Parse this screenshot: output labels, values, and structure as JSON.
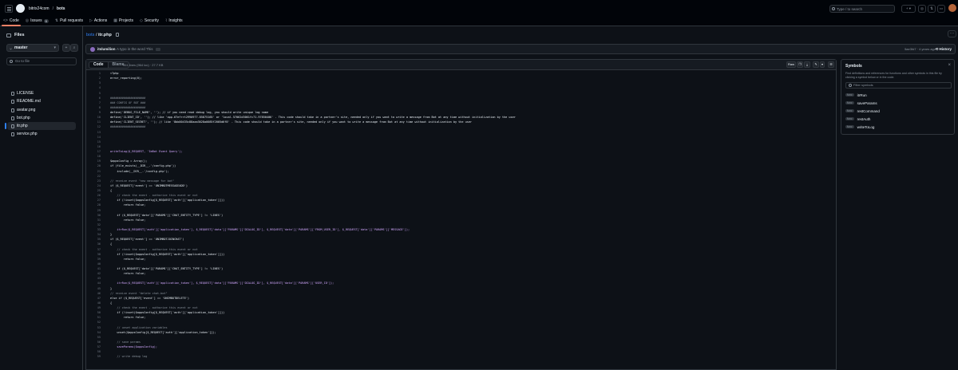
{
  "header": {
    "owner": "bitrix24com",
    "repo": "bots",
    "search_placeholder": "Type / to search",
    "add_label": "+ ▾"
  },
  "tabs": [
    {
      "label": "Code",
      "icon": "code-icon",
      "active": true
    },
    {
      "label": "Issues",
      "icon": "issue-icon",
      "count": "9"
    },
    {
      "label": "Pull requests",
      "icon": "pull-request-icon"
    },
    {
      "label": "Actions",
      "icon": "play-icon"
    },
    {
      "label": "Projects",
      "icon": "table-icon"
    },
    {
      "label": "Security",
      "icon": "shield-icon"
    },
    {
      "label": "Insights",
      "icon": "graph-icon"
    }
  ],
  "sidebar": {
    "title": "Files",
    "branch": "master",
    "goto_placeholder": "Go to file",
    "files": [
      {
        "name": "LICENSE"
      },
      {
        "name": "README.md"
      },
      {
        "name": "avatar.png"
      },
      {
        "name": "bot.php"
      },
      {
        "name": "itr.php",
        "selected": true
      },
      {
        "name": "service.php"
      }
    ]
  },
  "breadcrumb": {
    "repo": "bots",
    "sep": "/",
    "file": "itr.php"
  },
  "commit": {
    "author": "itslumilion",
    "message": "A typo in the word This",
    "sha": "5ae3fd7 · 4 years ago",
    "history_label": "History"
  },
  "codebar": {
    "code_tab": "Code",
    "blame_tab": "Blame",
    "meta": "961 lines (964 loc) · 27.7 KB",
    "raw_label": "Raw"
  },
  "code_lines": [
    {
      "n": "1",
      "t": "<?php"
    },
    {
      "n": "2",
      "t": "error_reporting(0);"
    },
    {
      "n": "3",
      "t": ""
    },
    {
      "n": "4",
      "t": ""
    },
    {
      "n": "5",
      "t": ""
    },
    {
      "n": "6",
      "t": "#####################",
      "c": true
    },
    {
      "n": "7",
      "t": "### CONFIG OF BOT ###",
      "c": true
    },
    {
      "n": "8",
      "t": "#####################",
      "c": true
    },
    {
      "n": "9",
      "t": "define('DEBUG_FILE_NAME', ''); // if you need read debug log, you should write unique log name"
    },
    {
      "n": "10",
      "t": "define('CLIENT_ID', ''); // like 'app.67efrrt2990977.85875165' or 'local.57062d3061fc71.97850406' - This code should take in a partner's site, needed only if you want to write a message from Bot at any time without initialization by the user"
    },
    {
      "n": "11",
      "t": "define('CLIENT_SECRET', ''); // like '8bb00435c88aaa3028a0085f2005d6f8' - This code should take in a partner's site, needed only if you want to write a message from Bot at any time without initialization by the user"
    },
    {
      "n": "12",
      "t": "#####################",
      "c": true
    },
    {
      "n": "13",
      "t": ""
    },
    {
      "n": "14",
      "t": ""
    },
    {
      "n": "15",
      "t": ""
    },
    {
      "n": "16",
      "t": ""
    },
    {
      "n": "17",
      "t": "writeToLog($_REQUEST, 'ImBot Event Query');",
      "f": true
    },
    {
      "n": "18",
      "t": ""
    },
    {
      "n": "19",
      "t": "$appsConfig = Array();"
    },
    {
      "n": "20",
      "t": "if (file_exists(__DIR__.'/config.php'))"
    },
    {
      "n": "21",
      "t": "    include(__DIR__.'/config.php');"
    },
    {
      "n": "22",
      "t": ""
    },
    {
      "n": "23",
      "t": "// receive event \"new message for bot\"",
      "c": true
    },
    {
      "n": "24",
      "t": "if ($_REQUEST['event'] == 'ONIMBOTMESSAGEADD')"
    },
    {
      "n": "25",
      "t": "{"
    },
    {
      "n": "26",
      "t": "    // check the event - authorize this event or not",
      "c": true
    },
    {
      "n": "27",
      "t": "    if (!isset($appsConfig[$_REQUEST['auth']['application_token']]))"
    },
    {
      "n": "28",
      "t": "        return false;"
    },
    {
      "n": "29",
      "t": ""
    },
    {
      "n": "30",
      "t": "    if ($_REQUEST['data']['PARAMS']['CHAT_ENTITY_TYPE'] != 'LINES')"
    },
    {
      "n": "31",
      "t": "        return false;"
    },
    {
      "n": "32",
      "t": ""
    },
    {
      "n": "33",
      "t": "    itrRun($_REQUEST['auth']['application_token'], $_REQUEST['data']['PARAMS']['DIALOG_ID'], $_REQUEST['data']['PARAMS']['FROM_USER_ID'], $_REQUEST['data']['PARAMS']['MESSAGE']);",
      "f": true
    },
    {
      "n": "34",
      "t": "}"
    },
    {
      "n": "35",
      "t": "if ($_REQUEST['event'] == 'ONIMBOTJOINCHAT')"
    },
    {
      "n": "36",
      "t": "{"
    },
    {
      "n": "37",
      "t": "    // check the event - authorize this event or not",
      "c": true
    },
    {
      "n": "38",
      "t": "    if (!isset($appsConfig[$_REQUEST['auth']['application_token']]))"
    },
    {
      "n": "39",
      "t": "        return false;"
    },
    {
      "n": "40",
      "t": ""
    },
    {
      "n": "41",
      "t": "    if ($_REQUEST['data']['PARAMS']['CHAT_ENTITY_TYPE'] != 'LINES')"
    },
    {
      "n": "42",
      "t": "        return false;"
    },
    {
      "n": "43",
      "t": ""
    },
    {
      "n": "44",
      "t": "    itrRun($_REQUEST['auth']['application_token'], $_REQUEST['data']['PARAMS']['DIALOG_ID'], $_REQUEST['data']['PARAMS']['USER_ID']);",
      "f": true
    },
    {
      "n": "45",
      "t": "}"
    },
    {
      "n": "46",
      "t": "// receive event \"delete chat-bot\"",
      "c": true
    },
    {
      "n": "47",
      "t": "else if ($_REQUEST['event'] == 'ONIMBOTDELETE')"
    },
    {
      "n": "48",
      "t": "{"
    },
    {
      "n": "49",
      "t": "    // check the event - authorize this event or not",
      "c": true
    },
    {
      "n": "50",
      "t": "    if (!isset($appsConfig[$_REQUEST['auth']['application_token']]))"
    },
    {
      "n": "51",
      "t": "        return false;"
    },
    {
      "n": "52",
      "t": ""
    },
    {
      "n": "53",
      "t": "    // unset application variables",
      "c": true
    },
    {
      "n": "54",
      "t": "    unset($appsConfig[$_REQUEST['auth']['application_token']]);"
    },
    {
      "n": "55",
      "t": ""
    },
    {
      "n": "56",
      "t": "    // save params",
      "c": true
    },
    {
      "n": "57",
      "t": "    saveParams($appsConfig);",
      "f": true
    },
    {
      "n": "58",
      "t": ""
    },
    {
      "n": "59",
      "t": "    // write debug log",
      "c": true
    }
  ],
  "symbols": {
    "title": "Symbols",
    "description": "Find definitions and references for functions and other symbols in this file by clicking a symbol below or in the code.",
    "filter_placeholder": "Filter symbols",
    "badge": "func",
    "items": [
      "itrRun",
      "saveParams",
      "restCommand",
      "restAuth",
      "writeToLog"
    ]
  },
  "colors": {
    "accent": "#2f81f7",
    "tab_underline": "#f78166",
    "bg": "#0d1117"
  }
}
